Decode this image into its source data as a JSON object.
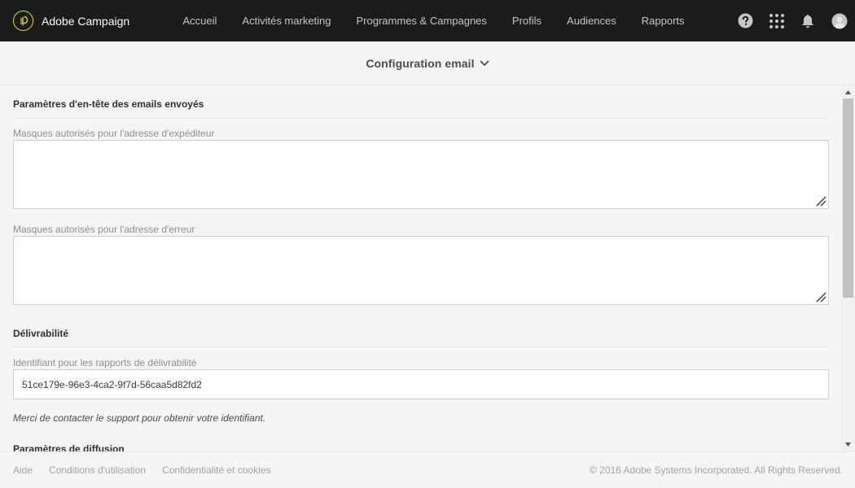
{
  "app": {
    "name": "Adobe Campaign",
    "logo_icon": "adobe-campaign-logo-icon"
  },
  "nav": {
    "items": [
      {
        "label": "Accueil"
      },
      {
        "label": "Activités marketing"
      },
      {
        "label": "Programmes & Campagnes"
      },
      {
        "label": "Profils"
      },
      {
        "label": "Audiences"
      },
      {
        "label": "Rapports"
      }
    ]
  },
  "top_icons": [
    "help-icon",
    "apps-grid-icon",
    "notification-bell-icon",
    "user-avatar-icon"
  ],
  "page": {
    "title": "Configuration email",
    "title_icon": "chevron-down-icon"
  },
  "sections": {
    "header_params": {
      "title": "Paramètres d'en-tête des emails envoyés",
      "sender_mask_label": "Masques autorisés pour l'adresse d'expéditeur",
      "sender_mask_value": "",
      "error_mask_label": "Masques autorisés pour l'adresse d'erreur",
      "error_mask_value": ""
    },
    "deliverability": {
      "title": "Délivrabilité",
      "id_label": "Identifiant pour les rapports de délivrabilité",
      "id_value": "51ce179e-96e3-4ca2-9f7d-56caa5d82fd2",
      "help_text": "Merci de contacter le support pour obtenir votre identifiant."
    },
    "delivery_params": {
      "title": "Paramètres de diffusion"
    }
  },
  "footer": {
    "links": [
      {
        "label": "Aide"
      },
      {
        "label": "Conditions d'utilisation"
      },
      {
        "label": "Confidentialité et cookies"
      }
    ],
    "copyright": "© 2016 Adobe Systems Incorporated. All Rights Reserved."
  },
  "colors": {
    "topbar_bg": "#1b1b1b",
    "logo_accent": "#d8d44a",
    "page_bg": "#f5f5f5"
  }
}
